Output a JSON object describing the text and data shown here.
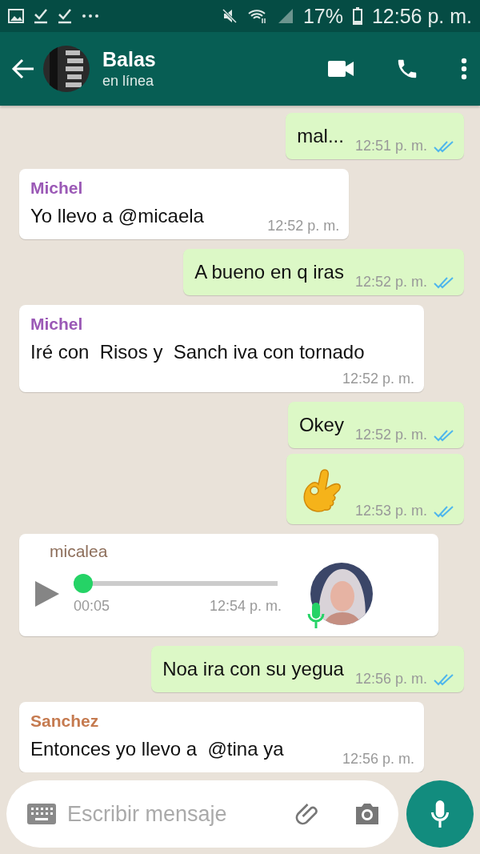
{
  "status_bar": {
    "battery": "17%",
    "time": "12:56 p. m."
  },
  "header": {
    "name": "Balas",
    "status": "en línea"
  },
  "messages": [
    {
      "kind": "text",
      "outgoing": true,
      "text": "mal...",
      "time": "12:51 p. m.",
      "read": true
    },
    {
      "kind": "text",
      "outgoing": false,
      "sender": "Michel",
      "color": "#9b59b6",
      "text": "Yo llevo a @micaela",
      "time": "12:52 p. m."
    },
    {
      "kind": "text",
      "outgoing": true,
      "text": "A bueno en q iras",
      "time": "12:52 p. m.",
      "read": true
    },
    {
      "kind": "text",
      "outgoing": false,
      "sender": "Michel",
      "color": "#9b59b6",
      "text": "Iré con  Risos y  Sanch iva con tornado",
      "time": "12:52 p. m."
    },
    {
      "kind": "text",
      "outgoing": true,
      "text": "Okey",
      "time": "12:52 p. m.",
      "read": true
    },
    {
      "kind": "emoji",
      "outgoing": true,
      "time": "12:53 p. m.",
      "read": true
    },
    {
      "kind": "voice",
      "outgoing": false,
      "sender": "micalea",
      "color": "#8d6e5a",
      "duration": "00:05",
      "time": "12:54 p. m.",
      "level": 0
    },
    {
      "kind": "text",
      "outgoing": true,
      "text": "Noa ira con su yegua",
      "time": "12:56 p. m.",
      "read": true
    },
    {
      "kind": "text",
      "outgoing": false,
      "sender": "Sanchez",
      "color": "#c57a4f",
      "text": "Entonces yo llevo a  @tina ya",
      "time": "12:56 p. m."
    }
  ],
  "composer": {
    "placeholder": "Escribir mensaje"
  }
}
